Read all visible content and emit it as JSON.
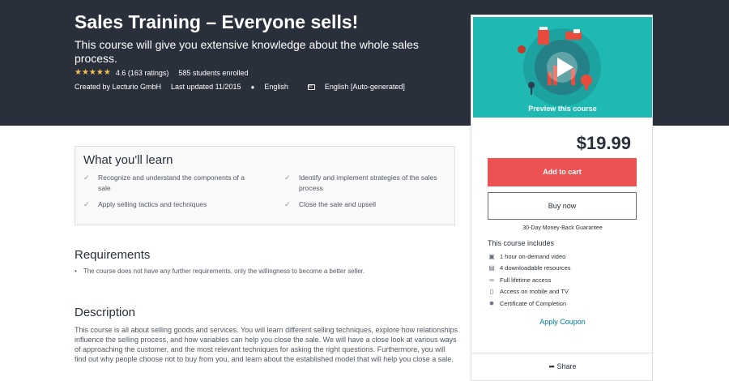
{
  "course": {
    "title": "Sales Training – Everyone sells!",
    "subtitle": "This course will give you extensive knowledge about the whole sales process.",
    "rating_value": "4.6",
    "rating_count": "(163 ratings)",
    "students": "585 students enrolled",
    "created_by": "Created by Lecturio GmbH",
    "last_updated": "Last updated 11/2015",
    "language": "English",
    "captions": "English [Auto-generated]",
    "stars_filled": 4.5
  },
  "sidebar": {
    "preview_label": "Preview this course",
    "price": "$19.99",
    "add_to_cart": "Add to cart",
    "buy_now": "Buy now",
    "guarantee": "30-Day Money-Back Guarantee",
    "includes_title": "This course includes",
    "includes": [
      {
        "icon": "video-icon",
        "text": "1 hour on-demand video"
      },
      {
        "icon": "file-icon",
        "text": "4 downloadable resources"
      },
      {
        "icon": "infinity-icon",
        "text": "Full lifetime access"
      },
      {
        "icon": "mobile-icon",
        "text": "Access on mobile and TV"
      },
      {
        "icon": "certificate-icon",
        "text": "Certificate of Completion"
      }
    ],
    "apply_coupon": "Apply Coupon",
    "share": "Share"
  },
  "learn": {
    "title": "What you'll learn",
    "items": [
      "Recognize and understand the components of a sale",
      "Identify and implement strategies of the sales process",
      "Apply selling tactics and techniques",
      "Close the sale and upsell"
    ]
  },
  "requirements": {
    "title": "Requirements",
    "items": [
      "The course does not have any further requirements, only the willingness to become a better seller."
    ]
  },
  "description": {
    "title": "Description",
    "text": "This course is all about selling goods and services. You will learn different selling techniques, explore how relationships influence the selling process, and how variables can help you close the sale. We will have a close look at various ways of approaching the customer, and the most relevant techniques for asking the right questions. Furthermore, you will find out why people choose not to buy from you, and learn about the established model that will help you close a sale."
  },
  "colors": {
    "hero_bg": "#29303b",
    "cart_button": "#ec5252",
    "stars": "#f4c150",
    "link": "#007791",
    "preview_bg": "#1fb9b4"
  }
}
